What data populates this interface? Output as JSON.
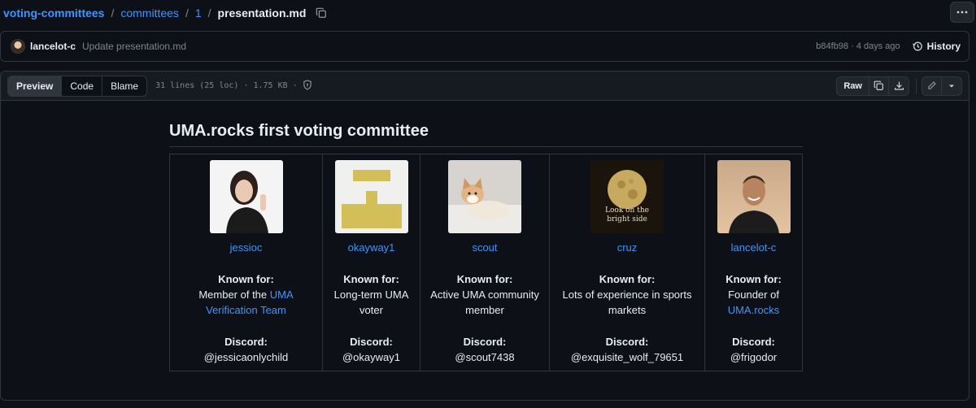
{
  "breadcrumb": {
    "repo": "voting-committees",
    "parts": [
      "committees",
      "1"
    ],
    "file": "presentation.md",
    "separator": "/"
  },
  "commit": {
    "author": "lancelot-c",
    "message": "Update presentation.md",
    "meta": "b84fb98 · 4 days ago",
    "history_label": "History"
  },
  "file_header": {
    "tabs": [
      "Preview",
      "Code",
      "Blame"
    ],
    "active_tab": "Preview",
    "info": "31 lines (25 loc) · 1.75 KB ·",
    "raw_label": "Raw"
  },
  "content": {
    "heading": "UMA.rocks first voting committee",
    "known_for_label": "Known for:",
    "discord_label": "Discord:",
    "members": [
      {
        "username": "jessioc",
        "known_for_prefix": "Member of the",
        "known_for_link": "UMA Verification Team",
        "known_for_suffix": "",
        "discord": "@jessicaonlychild",
        "avatar": "woman-portrait"
      },
      {
        "username": "okayway1",
        "known_for_prefix": "Long-term UMA voter",
        "known_for_link": "",
        "known_for_suffix": "",
        "discord": "@okayway1",
        "avatar": "yellow-identicon"
      },
      {
        "username": "scout",
        "known_for_prefix": "Active UMA community member",
        "known_for_link": "",
        "known_for_suffix": "",
        "discord": "@scout7438",
        "avatar": "puppy-photo"
      },
      {
        "username": "cruz",
        "known_for_prefix": "Lots of experience in sports markets",
        "known_for_link": "",
        "known_for_suffix": "",
        "discord": "@exquisite_wolf_79651",
        "avatar": "moon-photo",
        "avatar_caption": "Look on the bright side"
      },
      {
        "username": "lancelot-c",
        "known_for_prefix": "Founder of",
        "known_for_link": "UMA.rocks",
        "known_for_suffix": "",
        "discord": "@frigodor",
        "avatar": "man-portrait"
      }
    ]
  },
  "colors": {
    "background": "#0d1117",
    "link": "#4493f8",
    "border": "#30363d",
    "muted": "#7d8590"
  }
}
